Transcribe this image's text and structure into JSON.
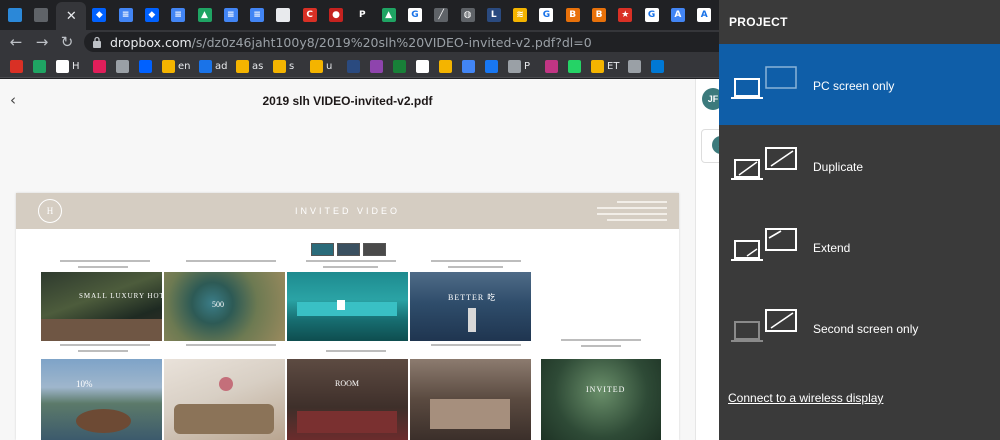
{
  "browser": {
    "url_host": "dropbox.com",
    "url_path": "/s/dz0z46jaht100y8/2019%20slh%20VIDEO-invited-v2.pdf?dl=0",
    "tab_close_glyph": "✕",
    "tabs": [
      {
        "icon": "windows-icon",
        "color": "#2b88d8",
        "letter": ""
      },
      {
        "icon": "chrome-gray-icon",
        "color": "#5f6368",
        "letter": ""
      },
      {
        "icon": "dropbox-icon",
        "color": "#0061ff",
        "letter": "◆"
      },
      {
        "icon": "docs-icon",
        "color": "#4285f4",
        "letter": "≡"
      },
      {
        "icon": "dropbox-icon",
        "color": "#0061ff",
        "letter": "◆"
      },
      {
        "icon": "docs-icon",
        "color": "#4285f4",
        "letter": "≡"
      },
      {
        "icon": "drive-icon",
        "color": "#1fa463",
        "letter": "▲"
      },
      {
        "icon": "docs-icon",
        "color": "#4285f4",
        "letter": "≡"
      },
      {
        "icon": "docs-icon",
        "color": "#4285f4",
        "letter": "≡"
      },
      {
        "icon": "file-icon",
        "color": "#e8eaed",
        "letter": ""
      },
      {
        "icon": "red-app-icon",
        "color": "#d93025",
        "letter": "C"
      },
      {
        "icon": "red-circle-icon",
        "color": "#c5221f",
        "letter": "●"
      },
      {
        "icon": "p-icon",
        "color": "#202124",
        "letter": "P"
      },
      {
        "icon": "drive-icon",
        "color": "#1fa463",
        "letter": "▲"
      },
      {
        "icon": "google-icon",
        "color": "#ffffff",
        "letter": "G"
      },
      {
        "icon": "line-icon",
        "color": "#5f6368",
        "letter": "╱"
      },
      {
        "icon": "globe-icon",
        "color": "#5f6368",
        "letter": "◍"
      },
      {
        "icon": "l-icon",
        "color": "#2a4a7f",
        "letter": "L"
      },
      {
        "icon": "stripes-icon",
        "color": "#f4b400",
        "letter": "≋"
      },
      {
        "icon": "google-icon",
        "color": "#ffffff",
        "letter": "G"
      },
      {
        "icon": "orange-app-icon",
        "color": "#e8710a",
        "letter": "B"
      },
      {
        "icon": "orange-app-icon",
        "color": "#e8710a",
        "letter": "B"
      },
      {
        "icon": "star-icon",
        "color": "#d93025",
        "letter": "★"
      },
      {
        "icon": "google-icon",
        "color": "#ffffff",
        "letter": "G"
      },
      {
        "icon": "doc-blue-icon",
        "color": "#4285f4",
        "letter": "A"
      },
      {
        "icon": "a-icon",
        "color": "#ffffff",
        "letter": "A"
      }
    ],
    "bookmarks": [
      {
        "icon": "gmail-icon",
        "color": "#d93025",
        "label": ""
      },
      {
        "icon": "drive-icon",
        "color": "#1fa463",
        "label": ""
      },
      {
        "icon": "g-icon",
        "color": "#ffffff",
        "label": "H"
      },
      {
        "icon": "slack-icon",
        "color": "#e01e5a",
        "label": ""
      },
      {
        "icon": "globe-icon",
        "color": "#9aa0a6",
        "label": ""
      },
      {
        "icon": "dropbox-icon",
        "color": "#0061ff",
        "label": ""
      },
      {
        "icon": "ba-icon",
        "color": "#f4b400",
        "label": "en"
      },
      {
        "icon": "edge-icon",
        "color": "#1a73e8",
        "label": "ad"
      },
      {
        "icon": "ba-icon",
        "color": "#f4b400",
        "label": "as"
      },
      {
        "icon": "ba-icon",
        "color": "#f4b400",
        "label": "s"
      },
      {
        "icon": "ba-icon",
        "color": "#f4b400",
        "label": "u"
      },
      {
        "icon": "l-icon",
        "color": "#2a4a7f",
        "label": ""
      },
      {
        "icon": "r-icon",
        "color": "#8e44ad",
        "label": ""
      },
      {
        "icon": "green-icon",
        "color": "#188038",
        "label": ""
      },
      {
        "icon": "w-icon",
        "color": "#ffffff",
        "label": ""
      },
      {
        "icon": "stripes-icon",
        "color": "#f4b400",
        "label": ""
      },
      {
        "icon": "stripes-blue-icon",
        "color": "#4285f4",
        "label": ""
      },
      {
        "icon": "facebook-icon",
        "color": "#1877f2",
        "label": ""
      },
      {
        "icon": "p-icon",
        "color": "#9aa0a6",
        "label": "P"
      },
      {
        "icon": "instagram-icon",
        "color": "#c13584",
        "label": ""
      },
      {
        "icon": "whatsapp-icon",
        "color": "#25d366",
        "label": ""
      },
      {
        "icon": "ba-icon",
        "color": "#f4b400",
        "label": "ET"
      },
      {
        "icon": "glasses-icon",
        "color": "#9aa0a6",
        "label": ""
      },
      {
        "icon": "outlook-icon",
        "color": "#0078d4",
        "label": ""
      }
    ]
  },
  "dropbox": {
    "file_title": "2019 slh VIDEO-invited-v2.pdf",
    "avatar_initials": "JF",
    "avatar_initial_small": "J",
    "pdf": {
      "heading": "INVITED VIDEO",
      "logo_letter": "H",
      "thumb_texts": [
        "SMALL LUXURY HOTELS",
        "500",
        "BETTER 吃",
        "10%",
        "ROOM",
        "INVITED"
      ]
    }
  },
  "project": {
    "title": "PROJECT",
    "modes": [
      {
        "label": "PC screen only",
        "selected": true
      },
      {
        "label": "Duplicate",
        "selected": false
      },
      {
        "label": "Extend",
        "selected": false
      },
      {
        "label": "Second screen only",
        "selected": false
      }
    ],
    "connect_link": "Connect to a wireless display"
  },
  "colors": {
    "selected_mode": "#0f5ea8",
    "flyout_bg": "#3a3a3a",
    "pdf_banner": "#d5cdc2"
  }
}
